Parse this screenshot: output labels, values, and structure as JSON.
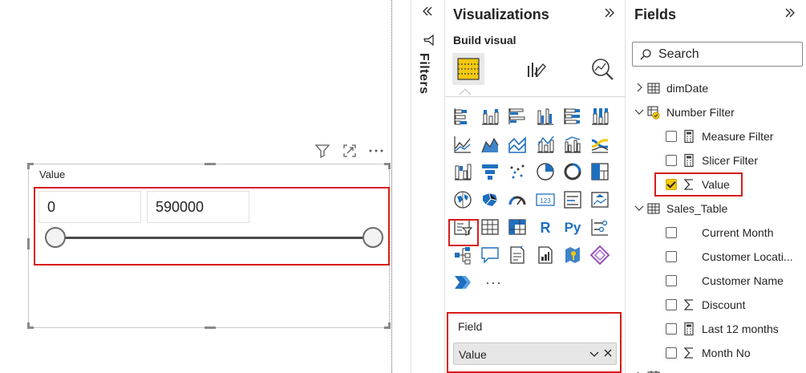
{
  "slicer": {
    "title": "Value",
    "range_min": "0",
    "range_max": "590000",
    "slider_min_fraction": 0,
    "slider_max_fraction": 1
  },
  "visual_header_icons": [
    "filter-icon",
    "focus-mode-icon",
    "more-options-icon"
  ],
  "filters": {
    "label": "Filters",
    "collapse_icon": "double-chevron-left-icon",
    "icon": "filter-icon"
  },
  "visualizations": {
    "title": "Visualizations",
    "expand_icon": "double-chevron-right-icon",
    "build_visual_label": "Build visual",
    "modes": [
      "build-visual-icon",
      "format-visual-icon",
      "analytics-icon"
    ],
    "gallery": [
      "stacked-bar-chart-icon",
      "stacked-column-chart-icon",
      "clustered-bar-chart-icon",
      "clustered-column-chart-icon",
      "100-stacked-bar-chart-icon",
      "100-stacked-column-chart-icon",
      "line-chart-icon",
      "area-chart-icon",
      "stacked-area-chart-icon",
      "line-and-stacked-column-chart-icon",
      "line-and-clustered-column-chart-icon",
      "ribbon-chart-icon",
      "waterfall-chart-icon",
      "funnel-chart-icon",
      "scatter-chart-icon",
      "pie-chart-icon",
      "donut-chart-icon",
      "treemap-icon",
      "map-icon",
      "filled-map-icon",
      "gauge-icon",
      "card-icon",
      "multi-row-card-icon",
      "kpi-icon",
      "slicer-icon",
      "table-icon",
      "matrix-icon",
      "r-script-visual-icon",
      "python-visual-icon",
      "key-influencers-icon",
      "decomposition-tree-icon",
      "qa-icon",
      "smart-narrative-icon",
      "paginated-report-icon",
      "azure-map-icon",
      "power-apps-icon",
      "power-automate-icon"
    ],
    "gallery_text": {
      "r-script-visual-icon": "R",
      "python-visual-icon": "Py"
    },
    "more_label": "···",
    "field_well": {
      "label": "Field",
      "value": "Value"
    }
  },
  "fields": {
    "title": "Fields",
    "expand_icon": "double-chevron-right-icon",
    "search_placeholder": "Search",
    "tree": [
      {
        "kind": "table",
        "label": "dimDate",
        "expanded": false,
        "icon": "table-icon"
      },
      {
        "kind": "table",
        "label": "Number Filter",
        "expanded": true,
        "icon": "measure-table-icon"
      },
      {
        "kind": "field",
        "label": "Measure Filter",
        "checked": false,
        "icon": "calculator-icon"
      },
      {
        "kind": "field",
        "label": "Slicer Filter",
        "checked": false,
        "icon": "calculator-icon"
      },
      {
        "kind": "field",
        "label": "Value",
        "checked": true,
        "icon": "sigma-icon"
      },
      {
        "kind": "table",
        "label": "Sales_Table",
        "expanded": true,
        "icon": "table-icon"
      },
      {
        "kind": "field",
        "label": "Current Month",
        "checked": false,
        "icon": ""
      },
      {
        "kind": "field",
        "label": "Customer Locati...",
        "checked": false,
        "icon": ""
      },
      {
        "kind": "field",
        "label": "Customer Name",
        "checked": false,
        "icon": ""
      },
      {
        "kind": "field",
        "label": "Discount",
        "checked": false,
        "icon": "sigma-icon"
      },
      {
        "kind": "field",
        "label": "Last 12 months",
        "checked": false,
        "icon": "calculator-icon"
      },
      {
        "kind": "field",
        "label": "Month No",
        "checked": false,
        "icon": "sigma-icon"
      },
      {
        "kind": "table",
        "label": "",
        "expanded": false,
        "icon": "calendar-icon"
      }
    ]
  },
  "colors": {
    "highlight_red": "#d81b1b",
    "check_yellow": "#f2c811",
    "icon_blue": "#1f6fbf",
    "icon_dark": "#3b3a39"
  }
}
